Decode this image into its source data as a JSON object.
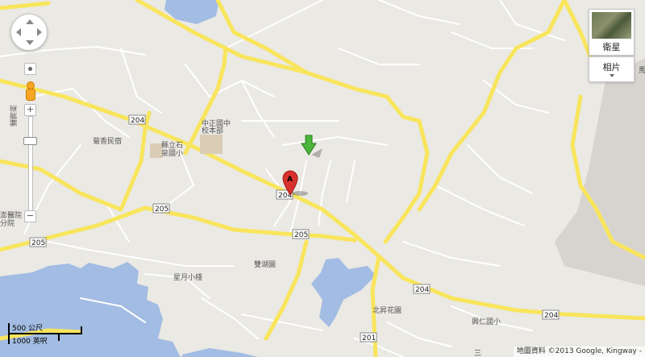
{
  "map": {
    "shields": [
      "204",
      "205",
      "201"
    ],
    "places": {
      "school1": "中正國中",
      "campus": "校本部",
      "school2a": "縣立石",
      "school2b": "泉國小",
      "minsu": "菊香民宿",
      "hosp_a": "澎醫院",
      "hosp_b": "分院",
      "lake": "雙湖園",
      "village": "星月小棧",
      "garden": "北昇花園",
      "school3": "興仁國小",
      "edge_right": "馬",
      "edge_left": "澎湖縣",
      "bottom_edge": "三"
    },
    "marker_a": "A",
    "colors": {
      "land": "#ebe9e4",
      "water": "#a2bce3",
      "road_major": "#f8e55c",
      "road_minor": "#ffffff",
      "airport": "#d7d4cf",
      "marker_red": "#d9322e",
      "arrow_green": "#4ab53a"
    }
  },
  "controls": {
    "pan_icon": "pan-arrows-icon",
    "pegman_icon": "pegman-icon",
    "zoom_in": "+",
    "zoom_out": "−",
    "satellite_label": "衛星",
    "photo_label": "相片"
  },
  "scale": {
    "metric": "500 公尺",
    "imperial": "1000 英呎"
  },
  "attribution": "地圖資料 ©2013 Google, Kingway -"
}
